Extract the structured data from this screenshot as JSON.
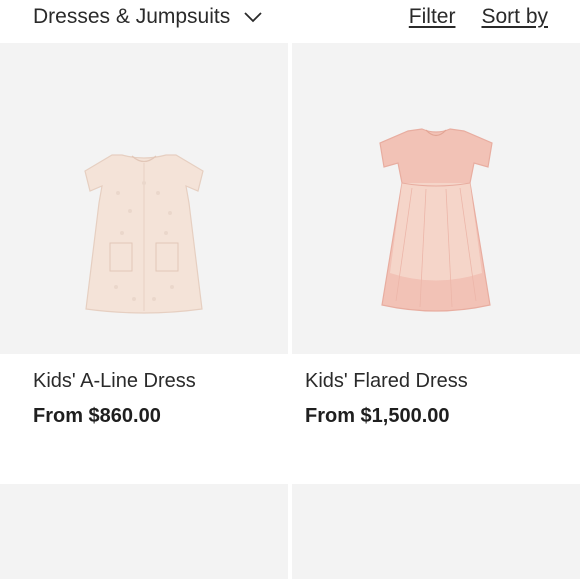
{
  "toolbar": {
    "category_label": "Dresses & Jumpsuits",
    "filter_label": "Filter",
    "sort_label": "Sort by"
  },
  "products": [
    {
      "name": "Kids' A-Line Dress",
      "price": "From $860.00",
      "image_color": "#f4e3d8"
    },
    {
      "name": "Kids' Flared Dress",
      "price": "From $1,500.00",
      "image_color": "#f2c2b6"
    }
  ],
  "icons": {
    "category_dropdown": "chevron-down-icon"
  }
}
